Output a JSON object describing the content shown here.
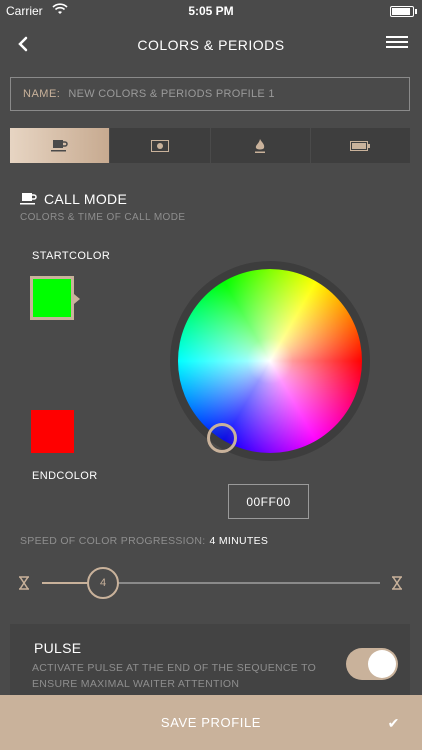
{
  "status": {
    "carrier": "Carrier",
    "time": "5:05 PM"
  },
  "nav": {
    "title": "COLORS & PERIODS"
  },
  "name_field": {
    "label": "NAME:",
    "placeholder": "NEW COLORS & PERIODS PROFILE 1"
  },
  "tabs": [
    {
      "icon": "coffee-cup-icon",
      "active": true
    },
    {
      "icon": "banknote-icon",
      "active": false
    },
    {
      "icon": "fire-icon",
      "active": false
    },
    {
      "icon": "battery-icon",
      "active": false
    }
  ],
  "section": {
    "title": "CALL MODE",
    "subtitle": "COLORS & TIME OF CALL MODE",
    "icon": "coffee-cup-icon"
  },
  "start": {
    "label": "STARTCOLOR",
    "color": "#00ff00"
  },
  "end": {
    "label": "ENDCOLOR",
    "color": "#ff0000"
  },
  "hex_value": "00FF00",
  "speed": {
    "label": "SPEED OF COLOR PROGRESSION:",
    "value": "4 MINUTES",
    "slider_value": "4",
    "slider_fraction": 0.18
  },
  "pulse": {
    "title": "PULSE",
    "description": "ACTIVATE PULSE AT THE END OF THE SEQUENCE TO ENSURE MAXIMAL WAITER ATTENTION",
    "enabled": true
  },
  "save": {
    "label": "SAVE PROFILE"
  },
  "colors": {
    "accent": "#c9b29b",
    "background": "#4a4a4a"
  }
}
